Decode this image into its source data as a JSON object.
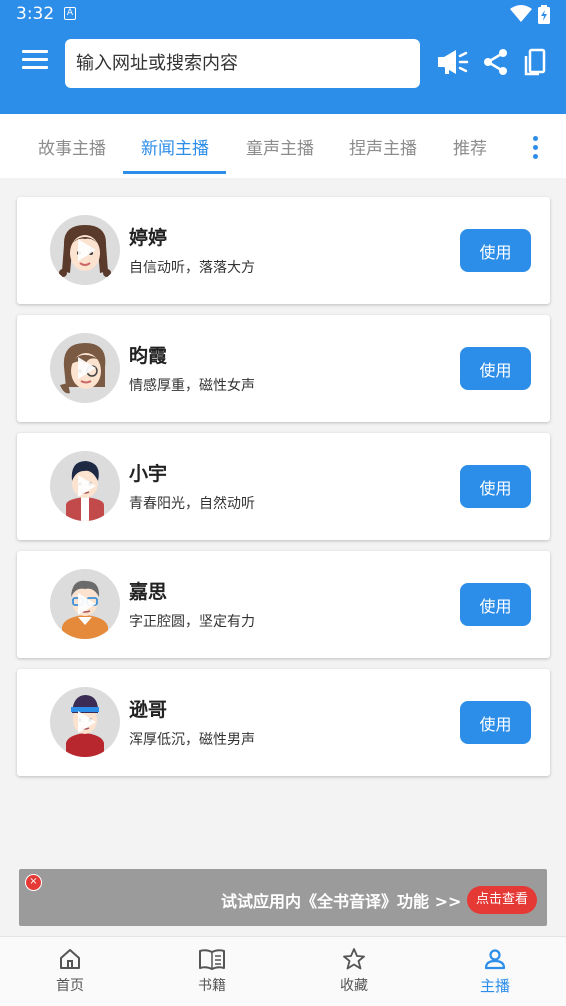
{
  "status": {
    "time": "3:32",
    "sim_glyph": "A"
  },
  "search": {
    "placeholder": "输入网址或搜索内容"
  },
  "tabs": [
    {
      "label": "故事主播"
    },
    {
      "label": "新闻主播"
    },
    {
      "label": "童声主播"
    },
    {
      "label": "捏声主播"
    },
    {
      "label": "推荐"
    }
  ],
  "anchors": [
    {
      "name": "婷婷",
      "desc": "自信动听，落落大方",
      "button": "使用"
    },
    {
      "name": "昀霞",
      "desc": "情感厚重，磁性女声",
      "button": "使用"
    },
    {
      "name": "小宇",
      "desc": "青春阳光，自然动听",
      "button": "使用"
    },
    {
      "name": "嘉思",
      "desc": "字正腔圆，坚定有力",
      "button": "使用"
    },
    {
      "name": "逊哥",
      "desc": "浑厚低沉，磁性男声",
      "button": "使用"
    }
  ],
  "ad": {
    "text": "试试应用内《全书音译》功能 >>",
    "button": "点击查看",
    "close_glyph": "×"
  },
  "bottom_nav": [
    {
      "label": "首页",
      "icon": "home-icon"
    },
    {
      "label": "书籍",
      "icon": "book-icon"
    },
    {
      "label": "收藏",
      "icon": "star-icon"
    },
    {
      "label": "主播",
      "icon": "person-icon"
    }
  ],
  "colors": {
    "primary": "#2d8ee9",
    "ad_red": "#e53935",
    "background": "#f3f3f3"
  }
}
